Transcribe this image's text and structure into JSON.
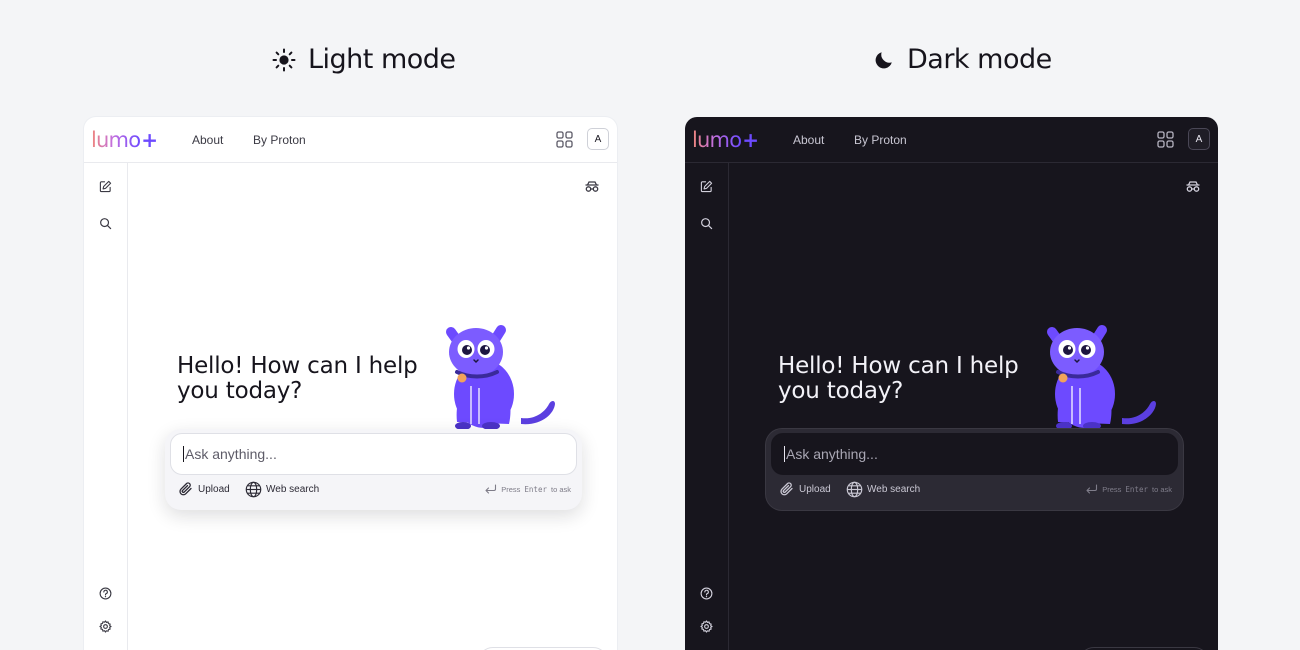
{
  "headings": {
    "light": "Light mode",
    "dark": "Dark mode"
  },
  "logo": {
    "word": "lumo",
    "plus": "+"
  },
  "nav": {
    "about": "About",
    "proton": "By Proton"
  },
  "avatar": {
    "initial": "A"
  },
  "greeting": "Hello! How can I help you today?",
  "composer": {
    "placeholder": "Ask anything...",
    "upload_label": "Upload",
    "web_search_label": "Web search",
    "hint_prefix": "Press",
    "hint_key": "Enter",
    "hint_suffix": "to ask"
  },
  "colors": {
    "accent": "#6d4aff",
    "light_bg": "#ffffff",
    "dark_bg": "#17151d"
  },
  "icons": {
    "light_heading": "sun-icon",
    "dark_heading": "moon-icon",
    "apps": "apps-grid-icon",
    "new_chat": "edit-icon",
    "search": "search-icon",
    "ghost": "incognito-icon",
    "help": "help-icon",
    "settings": "gear-icon",
    "upload": "paperclip-icon",
    "web": "globe-icon",
    "enter": "enter-icon"
  }
}
